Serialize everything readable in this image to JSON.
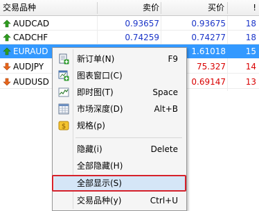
{
  "header": {
    "symbol_col": "交易品种",
    "bid_col": "卖价",
    "ask_col": "买价",
    "spread_col": "!"
  },
  "rows": [
    {
      "symbol": "AUDCAD",
      "bid": "0.93657",
      "ask": "0.93675",
      "spread": "18",
      "direction": "up",
      "selected": false
    },
    {
      "symbol": "CADCHF",
      "bid": "0.74259",
      "ask": "0.74277",
      "spread": "18",
      "direction": "up",
      "selected": false
    },
    {
      "symbol": "EURAUD",
      "bid": "",
      "ask": "1.61018",
      "spread": "15",
      "direction": "up",
      "selected": true
    },
    {
      "symbol": "AUDJPY",
      "bid": "",
      "ask": "75.327",
      "spread": "14",
      "direction": "down",
      "selected": false
    },
    {
      "symbol": "AUDUSD",
      "bid": "",
      "ask": "0.69147",
      "spread": "13",
      "direction": "down",
      "selected": false
    }
  ],
  "menu": {
    "items": [
      {
        "label": "新订单(N)",
        "shortcut": "F9",
        "icon": "new-order-icon"
      },
      {
        "label": "图表窗口(C)",
        "shortcut": "",
        "icon": "chart-window-icon"
      },
      {
        "label": "即时图(T)",
        "shortcut": "Space",
        "icon": "tick-chart-icon"
      },
      {
        "label": "市场深度(D)",
        "shortcut": "Alt+B",
        "icon": "market-depth-icon"
      },
      {
        "label": "规格(p)",
        "shortcut": "",
        "icon": "specification-icon"
      },
      {
        "label": "隐藏(i)",
        "shortcut": "Delete",
        "icon": ""
      },
      {
        "label": "全部隐藏(H)",
        "shortcut": "",
        "icon": ""
      },
      {
        "label": "全部显示(S)",
        "shortcut": "",
        "icon": ""
      },
      {
        "label": "交易品种(y)",
        "shortcut": "Ctrl+U",
        "icon": ""
      }
    ]
  },
  "colors": {
    "up_arrow": "#2f9e1f",
    "down_arrow": "#e8661c",
    "selection": "#3399ff",
    "highlight_border": "#d6212b",
    "bid_text": "#1b35c8",
    "ask_text": "#d90000"
  }
}
